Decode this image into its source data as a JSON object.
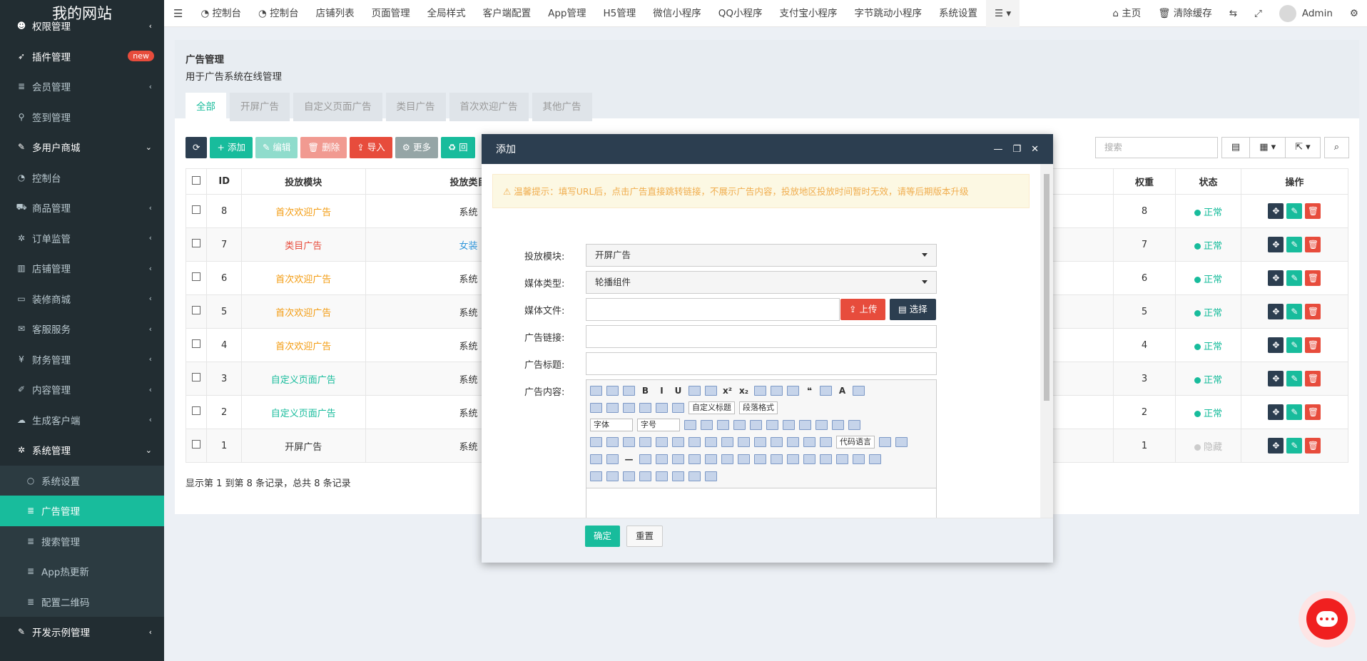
{
  "brand": "我的网站",
  "sidebar": [
    {
      "label": "权限管理",
      "icon": "user-icon"
    },
    {
      "label": "插件管理",
      "icon": "rocket-icon",
      "badge": "new"
    },
    {
      "label": "会员管理",
      "icon": "list-icon"
    },
    {
      "label": "签到管理",
      "icon": "map-pin-icon"
    },
    {
      "label": "多用户商城",
      "icon": "magic-icon"
    },
    {
      "label": "控制台",
      "icon": "dashboard-icon"
    },
    {
      "label": "商品管理",
      "icon": "cart-icon"
    },
    {
      "label": "订单监管",
      "icon": "gear-icon"
    },
    {
      "label": "店铺管理",
      "icon": "building-icon"
    },
    {
      "label": "装修商城",
      "icon": "monitor-icon"
    },
    {
      "label": "客服服务",
      "icon": "chat-icon"
    },
    {
      "label": "财务管理",
      "icon": "money-icon"
    },
    {
      "label": "内容管理",
      "icon": "edit-icon"
    },
    {
      "label": "生成客户端",
      "icon": "cloud-icon"
    },
    {
      "label": "系统管理",
      "icon": "gear-icon"
    },
    {
      "label": "系统设置",
      "icon": "circle-icon"
    },
    {
      "label": "广告管理",
      "icon": "list-icon"
    },
    {
      "label": "搜索管理",
      "icon": "list-icon"
    },
    {
      "label": "App热更新",
      "icon": "list-icon"
    },
    {
      "label": "配置二维码",
      "icon": "list-icon"
    },
    {
      "label": "开发示例管理",
      "icon": "magic-icon"
    }
  ],
  "topnav": [
    "控制台",
    "控制台",
    "店铺列表",
    "页面管理",
    "全局样式",
    "客户端配置",
    "App管理",
    "H5管理",
    "微信小程序",
    "QQ小程序",
    "支付宝小程序",
    "字节跳动小程序",
    "系统设置"
  ],
  "topright": {
    "home": "主页",
    "clear": "清除缓存",
    "user": "Admin"
  },
  "panel": {
    "title": "广告管理",
    "subtitle": "用于广告系统在线管理"
  },
  "tabs": [
    "全部",
    "开屏广告",
    "自定义页面广告",
    "类目广告",
    "首次欢迎广告",
    "其他广告"
  ],
  "toolbar": {
    "add": "添加",
    "edit": "编辑",
    "delete": "删除",
    "import": "导入",
    "more": "更多",
    "recycle": "回"
  },
  "search": {
    "placeholder": "搜索"
  },
  "table": {
    "headers": [
      "ID",
      "投放模块",
      "投放类目",
      "权重",
      "状态",
      "操作"
    ],
    "rows": [
      {
        "id": "8",
        "module": "首次欢迎广告",
        "cat": "系统",
        "weight": "8",
        "status": "正常"
      },
      {
        "id": "7",
        "module": "类目广告",
        "cat": "女装",
        "weight": "7",
        "status": "正常"
      },
      {
        "id": "6",
        "module": "首次欢迎广告",
        "cat": "系统",
        "weight": "6",
        "status": "正常"
      },
      {
        "id": "5",
        "module": "首次欢迎广告",
        "cat": "系统",
        "weight": "5",
        "status": "正常"
      },
      {
        "id": "4",
        "module": "首次欢迎广告",
        "cat": "系统",
        "weight": "4",
        "status": "正常"
      },
      {
        "id": "3",
        "module": "自定义页面广告",
        "cat": "系统",
        "weight": "3",
        "status": "正常"
      },
      {
        "id": "2",
        "module": "自定义页面广告",
        "cat": "系统",
        "weight": "2",
        "status": "正常"
      },
      {
        "id": "1",
        "module": "开屏广告",
        "cat": "系统",
        "weight": "1",
        "status": "隐藏"
      }
    ],
    "summary": "显示第 1 到第 8 条记录，总共 8 条记录"
  },
  "modal": {
    "title": "添加",
    "alert": "温馨提示：填写URL后，点击广告直接跳转链接，不展示广告内容，投放地区投放时间暂时无效，请等后期版本升级",
    "labels": {
      "module": "投放模块:",
      "media_type": "媒体类型:",
      "media_file": "媒体文件:",
      "link": "广告链接:",
      "title": "广告标题:",
      "content": "广告内容:"
    },
    "values": {
      "module": "开屏广告",
      "media_type": "轮播组件"
    },
    "upload": "上传",
    "choose": "选择",
    "editor": {
      "font": "字体",
      "size": "字号",
      "custom_title": "自定义标题",
      "paragraph": "段落格式",
      "code_lang": "代码语言"
    },
    "ok": "确定",
    "reset": "重置"
  }
}
